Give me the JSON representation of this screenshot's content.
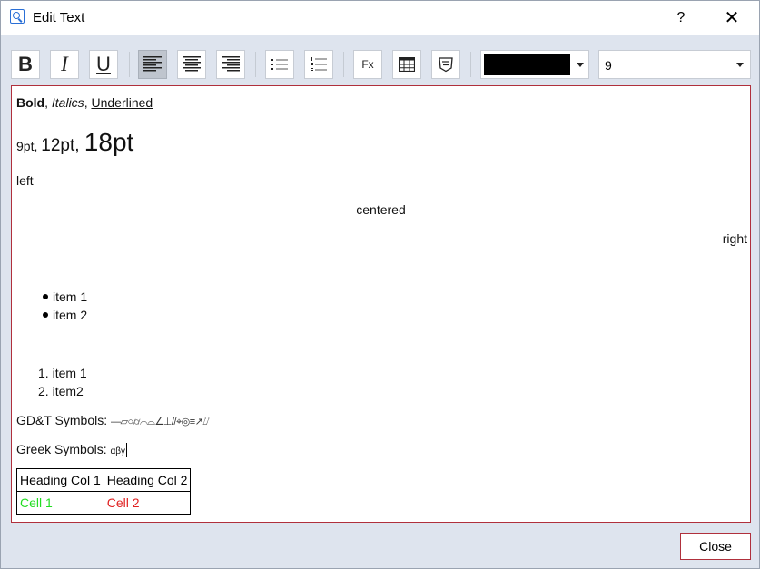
{
  "window": {
    "title": "Edit Text",
    "help_label": "?",
    "close_label": "✕"
  },
  "toolbar": {
    "bold_label": "B",
    "italic_label": "I",
    "underline_label": "U",
    "fx_label": "Fx",
    "text_color": "#000000",
    "font_size": "9"
  },
  "editor": {
    "line1": {
      "bold": "Bold",
      "sep1": ", ",
      "italic": "Italics",
      "sep2": ", ",
      "underline": "Underlined"
    },
    "sizes": {
      "s9": "9pt",
      "sep1": ", ",
      "s12": "12pt",
      "sep2": ", ",
      "s18": "18pt"
    },
    "left": "left",
    "centered": "centered",
    "right": "right",
    "bullets": [
      "item 1",
      "item 2"
    ],
    "numbered": [
      {
        "num": "1.",
        "text": "item 1"
      },
      {
        "num": "2.",
        "text": "item2"
      }
    ],
    "gdt_label": "GD&T Symbols: ",
    "gdt_symbols": "—⏥○⌭⌒⌓∠⊥//⌖◎≡↗⌰",
    "greek_label": "Greek Symbols: ",
    "greek_symbols": "αβγ",
    "table": {
      "headers": [
        "Heading Col 1",
        "Heading Col 2"
      ],
      "rows": [
        [
          "Cell 1",
          "Cell 2"
        ]
      ],
      "cell_colors": [
        "#22dd22",
        "#e02020"
      ]
    }
  },
  "footer": {
    "close_button": "Close"
  }
}
